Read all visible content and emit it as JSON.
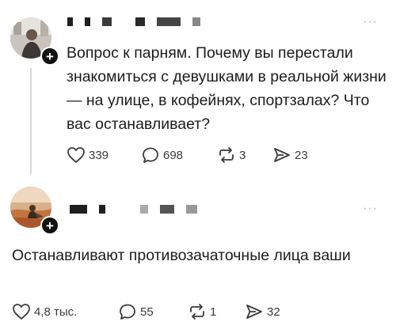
{
  "posts": [
    {
      "text": "Вопрос к парням. Почему вы перестали знакомиться с девушками в реальной жизни — на улице, в кофейнях, спортзалах? Что вас останавливает?",
      "follow_glyph": "+",
      "more_glyph": "···",
      "actions": {
        "likes": "339",
        "comments": "698",
        "reposts": "3",
        "shares": "23"
      }
    },
    {
      "text": "Останавливают противозачаточные лица ваши",
      "follow_glyph": "+",
      "more_glyph": "···",
      "actions": {
        "likes": "4,8 тыс.",
        "comments": "55",
        "reposts": "1",
        "shares": "32"
      }
    }
  ],
  "colors": {
    "text": "#1c1c1c",
    "icon": "#3b3b3b",
    "badge": "#111111",
    "thread_line": "#d9d9d9"
  }
}
